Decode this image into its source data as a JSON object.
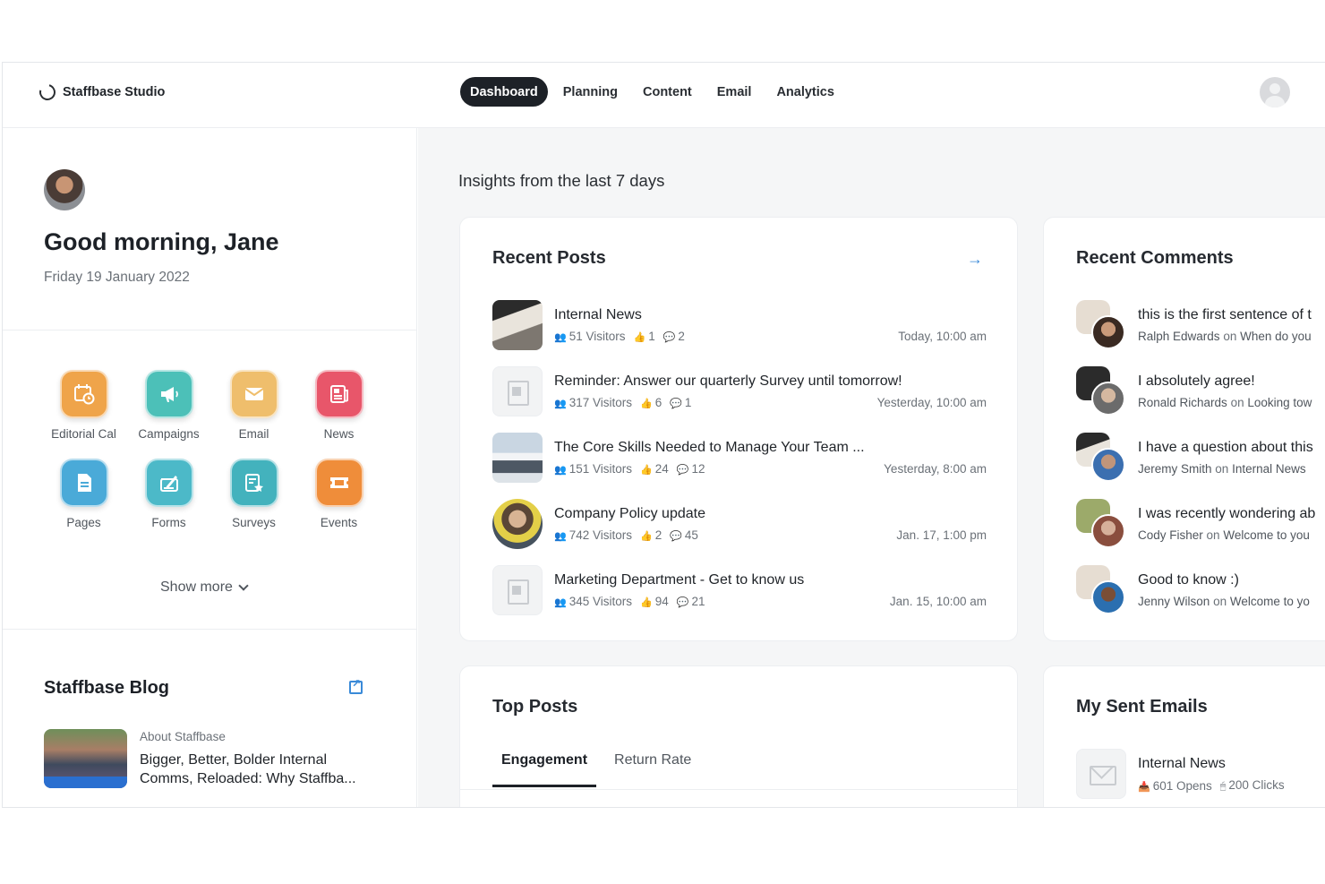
{
  "brand": {
    "name": "Staffbase Studio"
  },
  "nav": {
    "tabs": [
      {
        "label": "Dashboard",
        "active": true
      },
      {
        "label": "Planning",
        "active": false
      },
      {
        "label": "Content",
        "active": false
      },
      {
        "label": "Email",
        "active": false
      },
      {
        "label": "Analytics",
        "active": false
      }
    ]
  },
  "greeting": {
    "title": "Good morning, Jane",
    "date": "Friday 19 January 2022"
  },
  "apps": [
    {
      "label": "Editorial Cal",
      "icon": "calendar-clock-icon",
      "color": "#efa44a"
    },
    {
      "label": "Campaigns",
      "icon": "megaphone-icon",
      "color": "#4cc0b8"
    },
    {
      "label": "Email",
      "icon": "envelope-icon",
      "color": "#efbe6c"
    },
    {
      "label": "News",
      "icon": "newspaper-icon",
      "color": "#e8566a"
    },
    {
      "label": "Pages",
      "icon": "page-icon",
      "color": "#4aaad8"
    },
    {
      "label": "Forms",
      "icon": "form-edit-icon",
      "color": "#4cb9c8"
    },
    {
      "label": "Surveys",
      "icon": "survey-star-icon",
      "color": "#43b2bd"
    },
    {
      "label": "Events",
      "icon": "ticket-icon",
      "color": "#ef8d3a"
    }
  ],
  "show_more": "Show more",
  "blog": {
    "title": "Staffbase Blog",
    "category": "About Staffbase",
    "headline": "Bigger, Better, Bolder Internal Comms, Reloaded: Why Staffba..."
  },
  "main": {
    "insights": "Insights from the last 7 days"
  },
  "recent_posts": {
    "title": "Recent Posts",
    "items": [
      {
        "title": "Internal News",
        "visitors": "51 Visitors",
        "likes": "1",
        "comments": "2",
        "time": "Today, 10:00 am"
      },
      {
        "title": "Reminder: Answer our quarterly Survey until tomorrow!",
        "visitors": "317 Visitors",
        "likes": "6",
        "comments": "1",
        "time": "Yesterday, 10:00 am"
      },
      {
        "title": "The Core Skills Needed to Manage Your Team ...",
        "visitors": "151 Visitors",
        "likes": "24",
        "comments": "12",
        "time": "Yesterday, 8:00 am"
      },
      {
        "title": "Company Policy update",
        "visitors": "742 Visitors",
        "likes": "2",
        "comments": "45",
        "time": "Jan. 17, 1:00 pm"
      },
      {
        "title": "Marketing Department - Get to know us",
        "visitors": "345 Visitors",
        "likes": "94",
        "comments": "21",
        "time": "Jan. 15, 10:00 am"
      }
    ]
  },
  "recent_comments": {
    "title": "Recent Comments",
    "on_word": "on",
    "items": [
      {
        "text": "this is the first sentence of t",
        "author": "Ralph Edwards",
        "target": "When do you"
      },
      {
        "text": "I absolutely agree!",
        "author": "Ronald Richards",
        "target": "Looking tow"
      },
      {
        "text": "I have a question about this",
        "author": "Jeremy Smith",
        "target": "Internal News"
      },
      {
        "text": "I was recently wondering ab",
        "author": "Cody Fisher",
        "target": "Welcome to you"
      },
      {
        "text": "Good to know :)",
        "author": "Jenny Wilson",
        "target": "Welcome to yo"
      }
    ]
  },
  "top_posts": {
    "title": "Top Posts",
    "tabs": [
      {
        "label": "Engagement",
        "active": true
      },
      {
        "label": "Return Rate",
        "active": false
      }
    ]
  },
  "sent_emails": {
    "title": "My Sent Emails",
    "items": [
      {
        "title": "Internal News",
        "opens": "601 Opens",
        "clicks": "200 Clicks"
      }
    ]
  }
}
